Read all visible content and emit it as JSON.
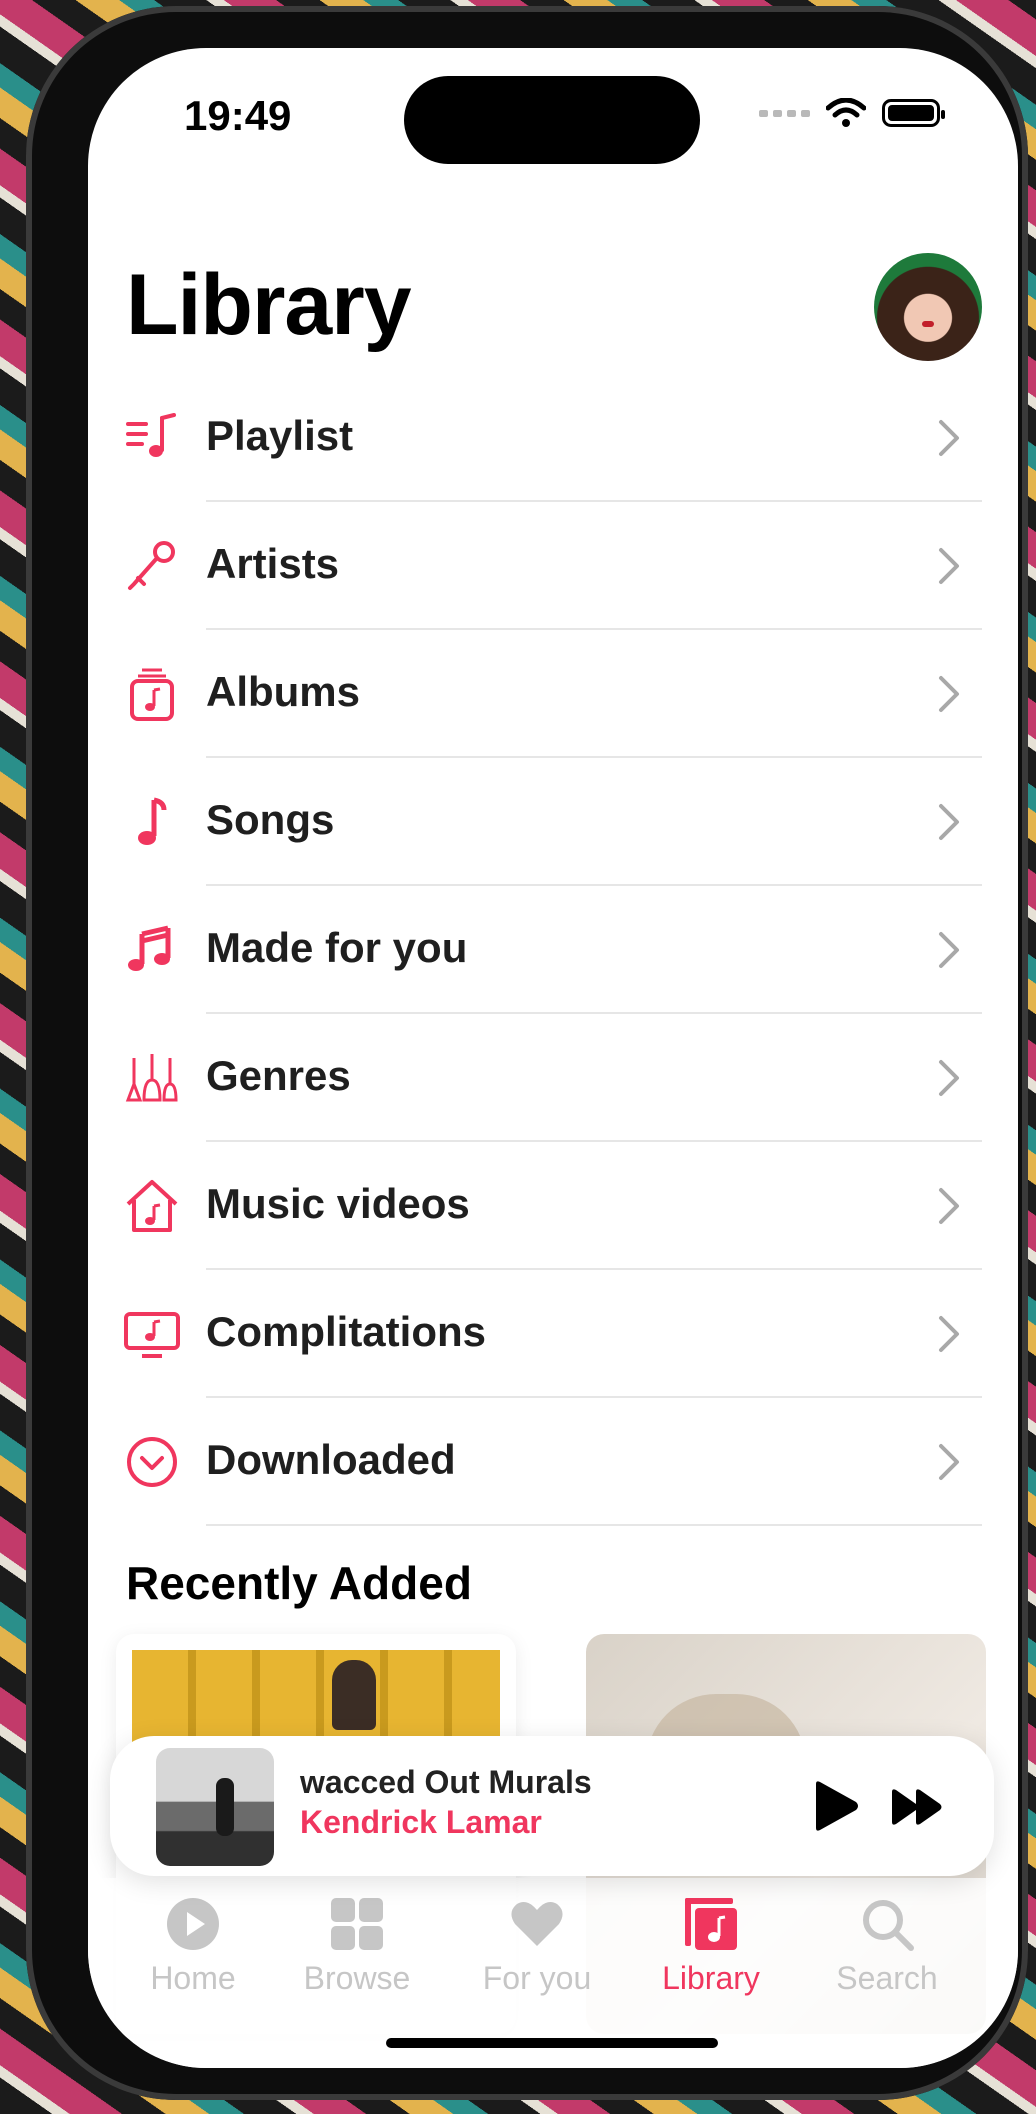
{
  "status": {
    "time": "19:49"
  },
  "header": {
    "title": "Library"
  },
  "menu": {
    "items": [
      {
        "label": "Playlist",
        "icon": "playlist-icon"
      },
      {
        "label": "Artists",
        "icon": "microphone-icon"
      },
      {
        "label": "Albums",
        "icon": "album-icon"
      },
      {
        "label": "Songs",
        "icon": "music-note-icon"
      },
      {
        "label": "Made for you",
        "icon": "music-notes-icon"
      },
      {
        "label": "Genres",
        "icon": "guitars-icon"
      },
      {
        "label": "Music videos",
        "icon": "music-house-icon"
      },
      {
        "label": "Complitations",
        "icon": "music-tv-icon"
      },
      {
        "label": "Downloaded",
        "icon": "download-circle-icon"
      }
    ]
  },
  "recent": {
    "title": "Recently Added"
  },
  "player": {
    "title": "wacced Out Murals",
    "artist": "Kendrick Lamar"
  },
  "tabs": [
    {
      "label": "Home",
      "icon": "play-circle-icon",
      "active": false
    },
    {
      "label": "Browse",
      "icon": "grid-icon",
      "active": false
    },
    {
      "label": "For you",
      "icon": "heart-icon",
      "active": false
    },
    {
      "label": "Library",
      "icon": "library-icon",
      "active": true
    },
    {
      "label": "Search",
      "icon": "search-icon",
      "active": false
    }
  ],
  "colors": {
    "accent": "#f0365e",
    "inactive": "#c6c6c6",
    "text": "#1f1f1f"
  }
}
